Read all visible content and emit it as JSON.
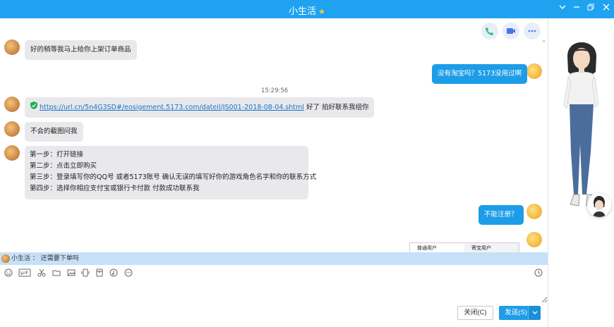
{
  "window": {
    "title": "小生活"
  },
  "messages": {
    "m1": "好的稍等我马上给你上架订单商品",
    "m2": "没有淘宝吗？5173没用过啊",
    "timestamp": "15:29:56",
    "m3_link": "https://url.cn/5n4G3SD#/eosigement.5173.com/dateil/JS001-2018-08-04.shtml",
    "m3_text": "好了 拍好联系我组你",
    "m4": "不会的截图问我",
    "m5_lines": [
      "第一步：打开链接",
      "第二步：点击立即购买",
      "第三步：登录填写你的QQ号 或者5173账号 确认无误的填写好你的游戏角色名字和你的联系方式",
      "第四步：选择你相应支付宝或银行卡付款 付款成功联系我"
    ],
    "m6": "不能注册？",
    "partial_tabs": [
      "普通用户",
      "寄宝用户"
    ]
  },
  "notice": {
    "text": "小生活 ：  还需要下单吗"
  },
  "buttons": {
    "close": "关闭(C)",
    "send": "发送(S)"
  },
  "icons": {
    "window": [
      "chevron-down-icon",
      "minimize-icon",
      "restore-icon",
      "close-icon"
    ],
    "header": [
      "phone-icon",
      "video-icon",
      "more-icon"
    ],
    "toolbar": [
      "emoji-icon",
      "gif-icon",
      "scissors-icon",
      "folder-icon",
      "image-icon",
      "phone-screen-icon",
      "red-packet-icon",
      "music-icon",
      "more-icon",
      "history-icon"
    ]
  },
  "colors": {
    "titlebar": "#1fa3f0",
    "my_bubble": "#1d9de8",
    "other_bubble": "#e9e9ec",
    "notice_bar": "#c6e0f8"
  }
}
